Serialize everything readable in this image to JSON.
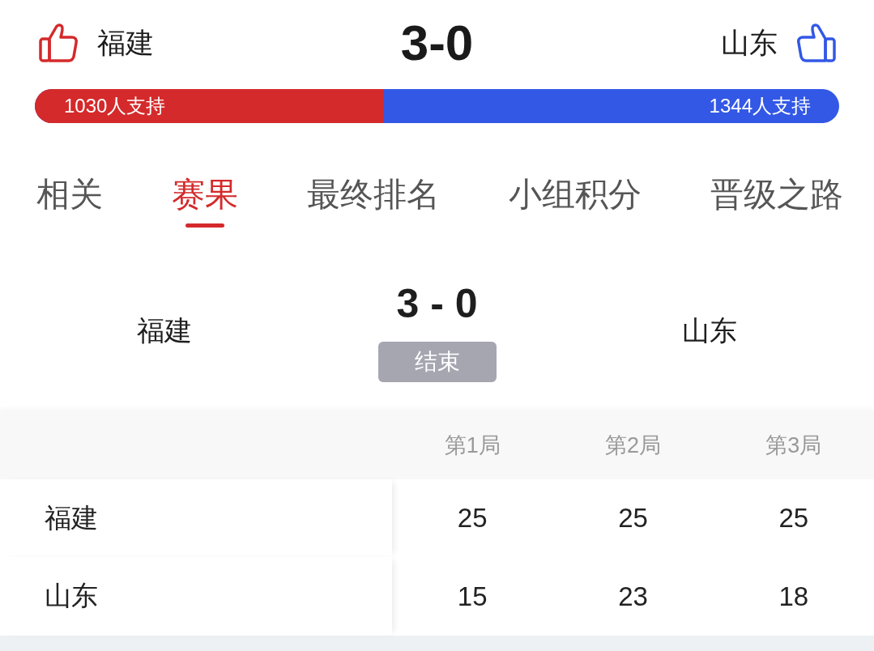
{
  "header": {
    "teams": [
      {
        "name": "福建",
        "color": "#d42a2b"
      },
      {
        "name": "山东",
        "color": "#3358e6"
      }
    ],
    "score": "3-0"
  },
  "support_bar": {
    "level": 0.434,
    "labels": [
      "1030人支持",
      "1344人支持"
    ]
  },
  "tabs": [
    {
      "label": "相关",
      "selected": false
    },
    {
      "label": "赛果",
      "selected": true
    },
    {
      "label": "最终排名",
      "selected": false
    },
    {
      "label": "小组积分",
      "selected": false
    },
    {
      "label": "晋级之路",
      "selected": false
    }
  ],
  "match": {
    "home": "福建",
    "score": "3 - 0",
    "status": "结束",
    "away": "山东"
  },
  "set_table": {
    "columns": [
      "第1局",
      "第2局",
      "第3局"
    ],
    "rows": [
      {
        "team": "福建",
        "scores": [
          "25",
          "25",
          "25"
        ]
      },
      {
        "team": "山东",
        "scores": [
          "15",
          "23",
          "18"
        ]
      }
    ]
  }
}
